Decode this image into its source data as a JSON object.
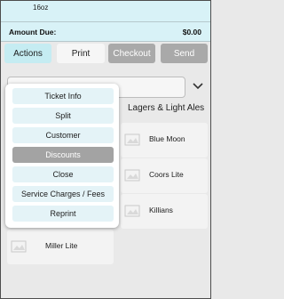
{
  "order": {
    "line_item": "16oz",
    "amount_due_label": "Amount Due:",
    "amount_due_value": "$0.00"
  },
  "toolbar": {
    "actions": "Actions",
    "print": "Print",
    "checkout": "Checkout",
    "send": "Send"
  },
  "category": {
    "active_tab": "Lagers & Light Ales"
  },
  "products": [
    {
      "name": "Blue Moon"
    },
    {
      "name": "Coors Lite"
    },
    {
      "name": "Killians"
    },
    {
      "name": "Miller Lite"
    }
  ],
  "actions_menu": {
    "items": [
      {
        "label": "Ticket Info"
      },
      {
        "label": "Split"
      },
      {
        "label": "Customer"
      },
      {
        "label": "Discounts",
        "selected": true
      },
      {
        "label": "Close"
      },
      {
        "label": "Service Charges / Fees"
      },
      {
        "label": "Reprint"
      }
    ]
  },
  "colors": {
    "accent_light": "#d8f2f7",
    "actions_button": "#c5ecf2",
    "disabled_button": "#a9a9a9",
    "menu_item": "#e4f3f7",
    "menu_item_selected": "#a3a3a3"
  },
  "icons": {
    "chevron": "chevron-down-icon",
    "product_thumb": "beer-image-placeholder-icon"
  }
}
